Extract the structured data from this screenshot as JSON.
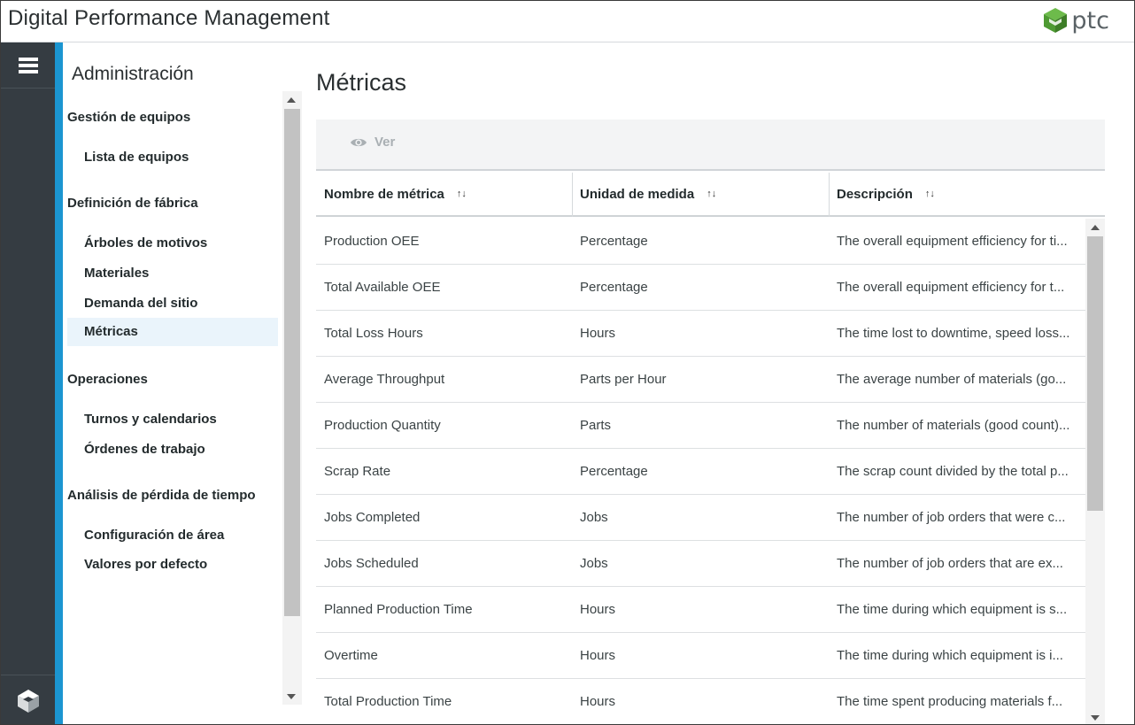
{
  "app": {
    "title": "Digital Performance Management",
    "logo_text": "ptc",
    "logo_icon": "ptc-logo-icon"
  },
  "rail": {
    "menu_icon": "hamburger-menu-icon",
    "bottom_icon": "thingworx-cube-icon"
  },
  "admin": {
    "title": "Administración",
    "sections": [
      {
        "label": "Gestión de equipos",
        "items": [
          {
            "label": "Lista de equipos",
            "active": false
          }
        ]
      },
      {
        "label": "Definición de fábrica",
        "items": [
          {
            "label": "Árboles de motivos",
            "active": false
          },
          {
            "label": "Materiales",
            "active": false
          },
          {
            "label": "Demanda del sitio",
            "active": false
          },
          {
            "label": "Métricas",
            "active": true
          }
        ]
      },
      {
        "label": "Operaciones",
        "items": [
          {
            "label": "Turnos y calendarios",
            "active": false
          },
          {
            "label": "Órdenes de trabajo",
            "active": false
          }
        ]
      },
      {
        "label": "Análisis de pérdida de tiempo",
        "items": [
          {
            "label": "Configuración de área",
            "active": false
          },
          {
            "label": "Valores por defecto",
            "active": false
          }
        ]
      }
    ]
  },
  "main": {
    "title": "Métricas",
    "toolbar": {
      "view_label": "Ver",
      "view_icon": "eye-icon"
    },
    "table": {
      "columns": [
        {
          "label": "Nombre de métrica",
          "sort_icon": "sort-arrows-icon"
        },
        {
          "label": "Unidad de medida",
          "sort_icon": "sort-arrows-icon"
        },
        {
          "label": "Descripción",
          "sort_icon": "sort-arrows-icon"
        }
      ],
      "rows": [
        {
          "name": "Production OEE",
          "unit": "Percentage",
          "description": "The overall equipment efficiency for ti..."
        },
        {
          "name": "Total Available OEE",
          "unit": "Percentage",
          "description": "The overall equipment efficiency for t..."
        },
        {
          "name": "Total Loss Hours",
          "unit": "Hours",
          "description": "The time lost to downtime, speed loss..."
        },
        {
          "name": "Average Throughput",
          "unit": "Parts per Hour",
          "description": "The average number of materials (go..."
        },
        {
          "name": "Production Quantity",
          "unit": "Parts",
          "description": "The number of materials (good count)..."
        },
        {
          "name": "Scrap Rate",
          "unit": "Percentage",
          "description": "The scrap count divided by the total p..."
        },
        {
          "name": "Jobs Completed",
          "unit": "Jobs",
          "description": "The number of job orders that were c..."
        },
        {
          "name": "Jobs Scheduled",
          "unit": "Jobs",
          "description": "The number of job orders that are ex..."
        },
        {
          "name": "Planned Production Time",
          "unit": "Hours",
          "description": "The time during which equipment is s..."
        },
        {
          "name": "Overtime",
          "unit": "Hours",
          "description": "The time during which equipment is i..."
        },
        {
          "name": "Total Production Time",
          "unit": "Hours",
          "description": "The time spent producing materials f..."
        }
      ]
    }
  },
  "colors": {
    "accent": "#1b95d1",
    "rail": "#353c42",
    "active_item_bg": "#eaf4fb"
  }
}
